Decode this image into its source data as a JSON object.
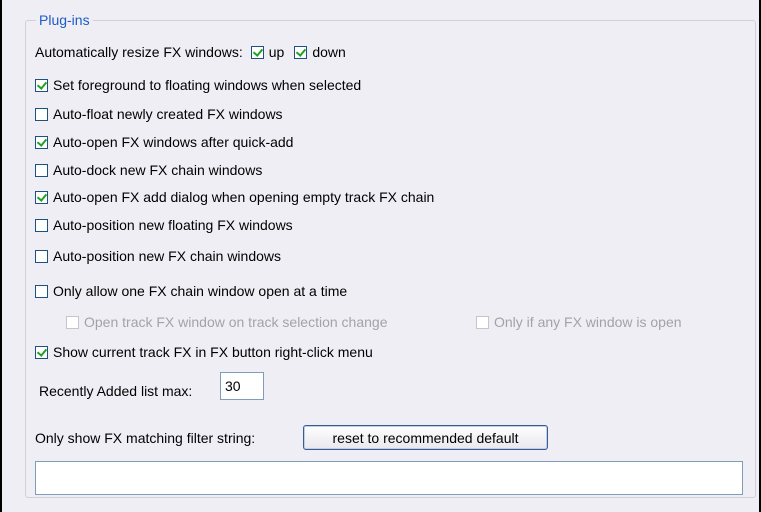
{
  "group": {
    "title": "Plug-ins"
  },
  "resize": {
    "label": "Automatically resize FX windows:",
    "up": {
      "label": "up",
      "checked": true
    },
    "down": {
      "label": "down",
      "checked": true
    }
  },
  "options": [
    {
      "label": "Set foreground to floating windows when selected",
      "checked": true
    },
    {
      "label": "Auto-float newly created FX windows",
      "checked": false
    },
    {
      "label": "Auto-open FX windows after quick-add",
      "checked": true
    },
    {
      "label": "Auto-dock new FX chain windows",
      "checked": false
    },
    {
      "label": "Auto-open FX add dialog when opening empty track FX chain",
      "checked": true
    },
    {
      "label": "Auto-position new floating FX windows",
      "checked": false
    },
    {
      "label": "Auto-position new FX chain windows",
      "checked": false
    },
    {
      "label": "Only allow one FX chain window open at a time",
      "checked": false
    }
  ],
  "sub_options": [
    {
      "label": "Open track FX window on track selection change",
      "checked": false,
      "disabled": true
    },
    {
      "label": "Only if any FX window is open",
      "checked": false,
      "disabled": true
    }
  ],
  "show_current": {
    "label": "Show current track FX in FX button right-click menu",
    "checked": true
  },
  "recent": {
    "label": "Recently Added list max:",
    "value": "30"
  },
  "filter": {
    "label": "Only show FX matching filter string:",
    "reset_label": "reset to recommended default",
    "value": ""
  }
}
